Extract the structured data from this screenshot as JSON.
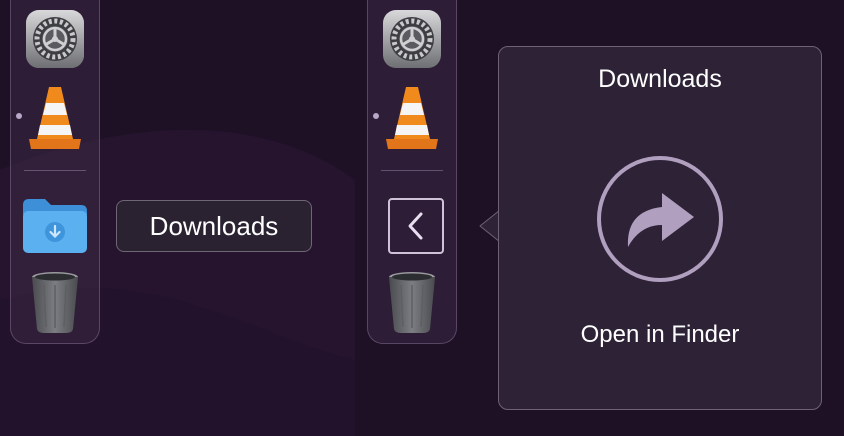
{
  "dock_left": {
    "items": [
      {
        "name": "system-settings",
        "icon": "gear-icon"
      },
      {
        "name": "vlc",
        "icon": "traffic-cone-icon",
        "running": true
      },
      {
        "name": "downloads-folder",
        "icon": "folder-download-icon"
      },
      {
        "name": "trash",
        "icon": "trash-icon"
      }
    ],
    "tooltip": "Downloads"
  },
  "dock_right": {
    "items": [
      {
        "name": "system-settings",
        "icon": "gear-icon"
      },
      {
        "name": "vlc",
        "icon": "traffic-cone-icon",
        "running": true
      },
      {
        "name": "stack-back",
        "icon": "chevron-left-icon"
      },
      {
        "name": "trash",
        "icon": "trash-icon"
      }
    ]
  },
  "popover": {
    "title": "Downloads",
    "action_icon": "share-arrow-icon",
    "action_label": "Open in Finder"
  },
  "colors": {
    "background": "#1e1126",
    "popover_bg": "#2e2237",
    "folder_blue": "#5bb1ef",
    "vlc_orange": "#f08a1c",
    "accent_lilac": "#b9a7c9"
  }
}
